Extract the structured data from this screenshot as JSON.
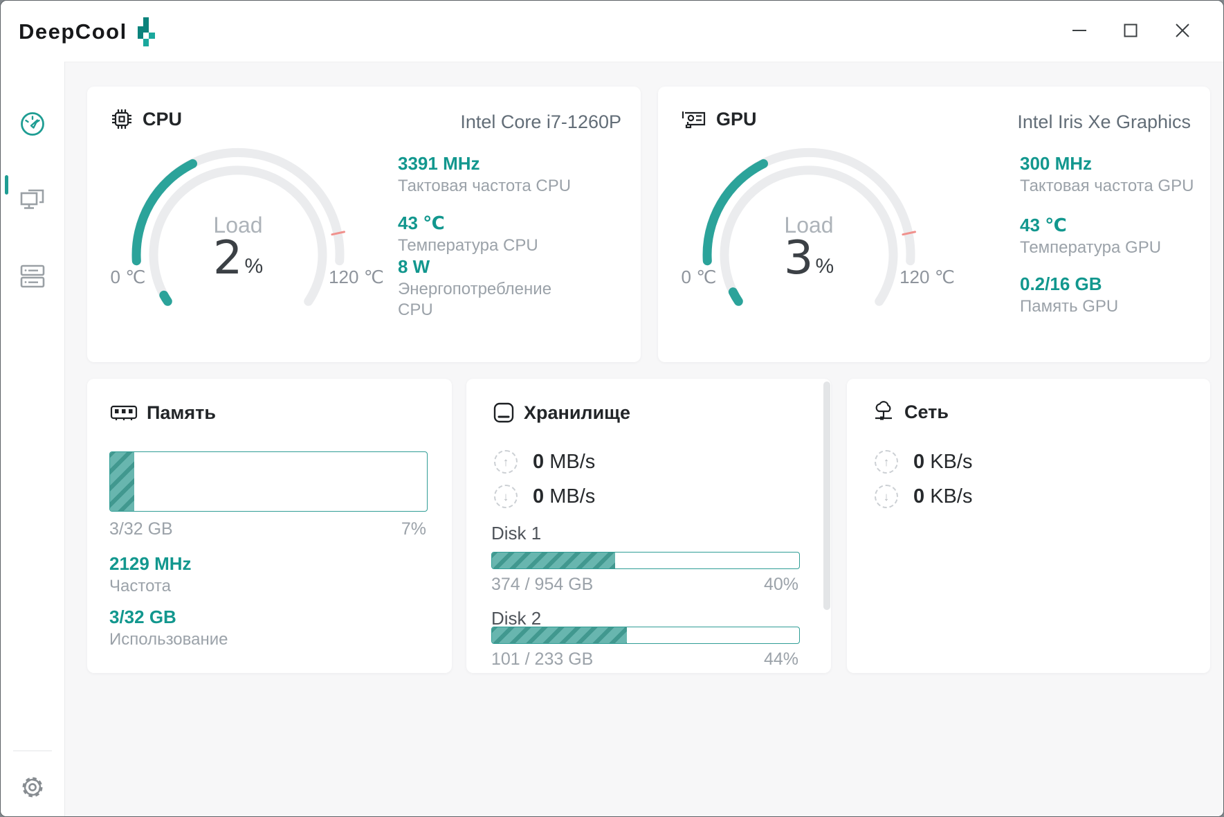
{
  "window": {
    "brand": "DeepCool",
    "controls": {
      "minimize": "minimize",
      "maximize": "maximize",
      "close": "close"
    }
  },
  "colors": {
    "accent": "#1f9d93",
    "accent_text": "#12978e",
    "arc_teal": "#2ba39a",
    "arc_gray": "#ebecee",
    "red_tick": "#f0918d",
    "hatch_dark": "#41988f",
    "hatch_light": "#68b6af"
  },
  "sidebar": {
    "items": [
      {
        "name": "dashboard",
        "active": true
      },
      {
        "name": "displays",
        "active": false
      },
      {
        "name": "devices",
        "active": false
      },
      {
        "name": "settings",
        "active": false
      }
    ]
  },
  "cards": {
    "cpu": {
      "title": "CPU",
      "device": "Intel Core i7-1260P",
      "gauge": {
        "load_label": "Load",
        "load_percent": 2,
        "percent_sign": "%",
        "temp_c": 43,
        "temp_max": 120,
        "tick_c": 110,
        "min_label": "0 ℃",
        "max_label": "120 ℃"
      },
      "stats": [
        {
          "value": "3391 MHz",
          "label": "Тактовая частота CPU"
        },
        {
          "value": "43 ℃",
          "label": "Температура CPU"
        },
        {
          "value": "8 W",
          "label": "Энергопотребление CPU"
        }
      ]
    },
    "gpu": {
      "title": "GPU",
      "device": "Intel Iris Xe Graphics",
      "gauge": {
        "load_label": "Load",
        "load_percent": 3,
        "percent_sign": "%",
        "temp_c": 43,
        "temp_max": 120,
        "tick_c": 110,
        "min_label": "0 ℃",
        "max_label": "120 ℃"
      },
      "stats": [
        {
          "value": "300 MHz",
          "label": "Тактовая частота GPU"
        },
        {
          "value": "43 ℃",
          "label": "Температура GPU"
        },
        {
          "value": "0.2/16 GB",
          "label": "Память GPU"
        }
      ]
    },
    "memory": {
      "title": "Память",
      "bar": {
        "percent": 7.6,
        "used_label": "3/32 GB",
        "percent_label": "7%"
      },
      "stats": [
        {
          "value": "2129 MHz",
          "label": "Частота"
        },
        {
          "value": "3/32 GB",
          "label": "Использование"
        }
      ]
    },
    "storage": {
      "title": "Хранилище",
      "io": [
        {
          "value": "0",
          "unit": " MB/s",
          "dir": "up"
        },
        {
          "value": "0",
          "unit": " MB/s",
          "dir": "down"
        }
      ],
      "disks": [
        {
          "name": "Disk 1",
          "used_label": "374 / 954 GB",
          "percent_label": "40%",
          "percent": 40
        },
        {
          "name": "Disk 2",
          "used_label": "101 / 233 GB",
          "percent_label": "44%",
          "percent": 44
        }
      ]
    },
    "network": {
      "title": "Сеть",
      "io": [
        {
          "value": "0",
          "unit": " KB/s",
          "dir": "up"
        },
        {
          "value": "0",
          "unit": " KB/s",
          "dir": "down"
        }
      ]
    }
  },
  "io_icons": {
    "up": "↑",
    "down": "↓"
  }
}
